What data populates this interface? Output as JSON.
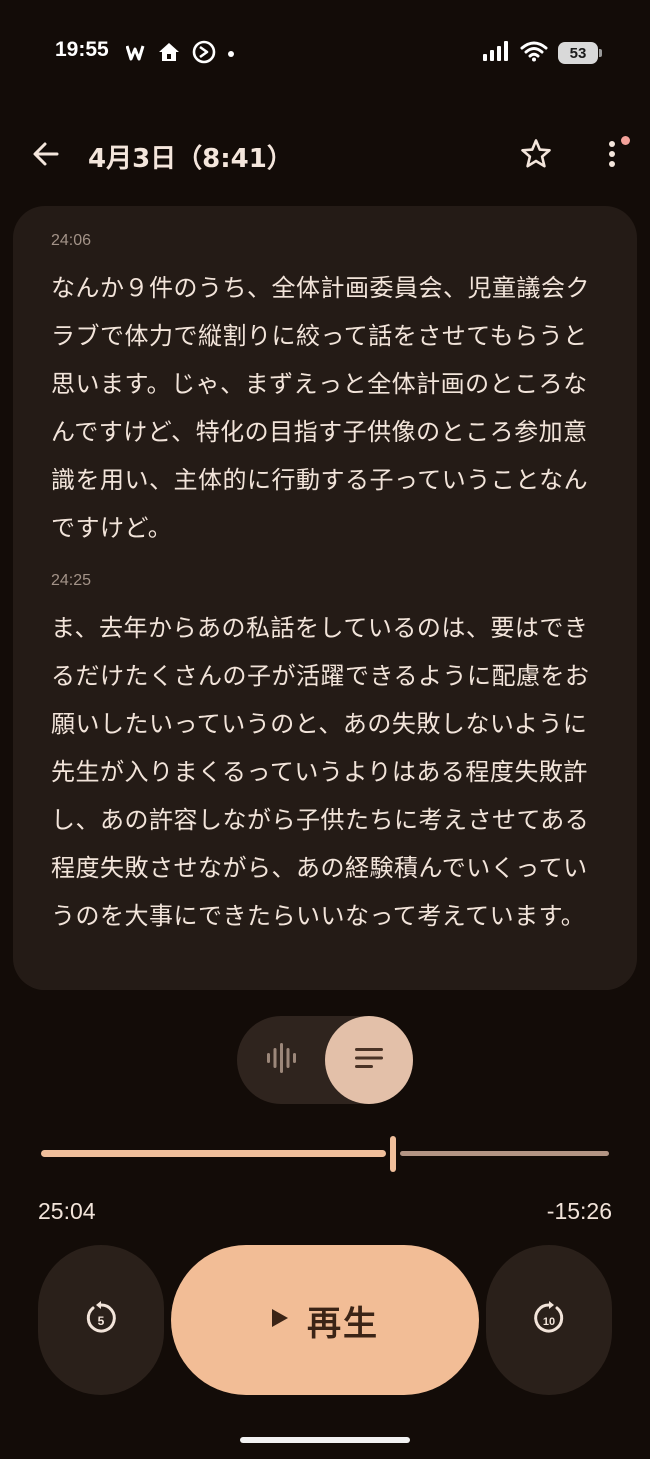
{
  "status_bar": {
    "time": "19:55",
    "battery": "53",
    "icons": [
      "w-app-icon",
      "home-icon",
      "sync-icon",
      "dot-icon",
      "signal-icon",
      "wifi-icon",
      "battery-icon"
    ]
  },
  "header": {
    "title": "4月3日（8:41）",
    "icons": [
      "back-arrow-icon",
      "star-outline-icon",
      "more-vert-icon"
    ],
    "notification_dot_color": "#f4a29a"
  },
  "transcript": {
    "segments": [
      {
        "time": "24:06",
        "text": "なんか９件のうち、全体計画委員会、児童議会クラブで体力で縦割りに絞って話をさせてもらうと思います。じゃ、まずえっと全体計画のところなんですけど、特化の目指す子供像のところ参加意識を用い、主体的に行動する子っていうことなんですけど。"
      },
      {
        "time": "24:25",
        "text": "ま、去年からあの私話をしているのは、要はできるだけたくさんの子が活躍できるように配慮をお願いしたいっていうのと、あの失敗しないように先生が入りまくるっていうよりはある程度失敗許し、あの許容しながら子供たちに考えさせてある程度失敗させながら、あの経験積んでいくっていうのを大事にできたらいいなって考えています。"
      }
    ]
  },
  "view_toggle": {
    "options": [
      "waveform-icon",
      "transcript-icon"
    ],
    "selected": "transcript-icon"
  },
  "playback": {
    "elapsed": "25:04",
    "remaining": "-15:26",
    "progress": 0.619
  },
  "controls": {
    "rewind_seconds": "5",
    "forward_seconds": "10",
    "play_label": "再生"
  },
  "colors": {
    "background": "#130c08",
    "card": "#241b16",
    "accent": "#f2bd96",
    "toggle_selected": "#e3c0a9"
  }
}
